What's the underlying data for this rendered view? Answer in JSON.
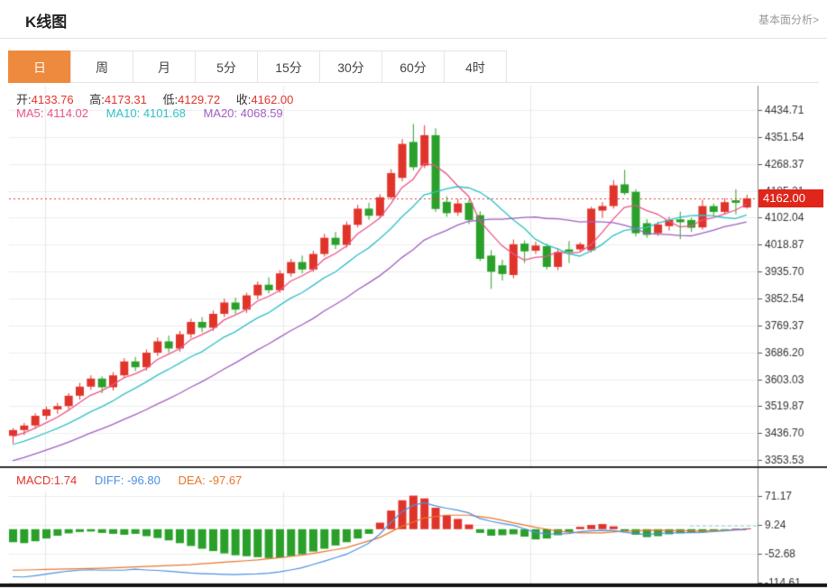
{
  "header": {
    "title": "K线图",
    "analysis_link": "基本面分析>"
  },
  "tabs": {
    "items": [
      {
        "label": "日",
        "active": true
      },
      {
        "label": "周",
        "active": false
      },
      {
        "label": "月",
        "active": false
      },
      {
        "label": "5分",
        "active": false
      },
      {
        "label": "15分",
        "active": false
      },
      {
        "label": "30分",
        "active": false
      },
      {
        "label": "60分",
        "active": false
      },
      {
        "label": "4时",
        "active": false
      }
    ]
  },
  "ohlc": {
    "open_label": "开:",
    "open_value": "4133.76",
    "high_label": "高:",
    "high_value": "4173.31",
    "low_label": "低:",
    "low_value": "4129.72",
    "close_label": "收:",
    "close_value": "4162.00"
  },
  "ma": {
    "ma5_label": "MA5:",
    "ma5_value": "4114.02",
    "ma10_label": "MA10:",
    "ma10_value": "4101.68",
    "ma20_label": "MA20:",
    "ma20_value": "4068.59"
  },
  "macd_legend": {
    "macd_label": "MACD:",
    "macd_value": "1.74",
    "diff_label": "DIFF:",
    "diff_value": "-96.80",
    "dea_label": "DEA:",
    "dea_value": "-97.67"
  },
  "price_marker": {
    "label": "4162.00"
  },
  "colors": {
    "up": "#e0342b",
    "down": "#2aa02a",
    "ma5": "#ea5586",
    "ma10": "#2fc1c9",
    "ma20": "#a05fc0",
    "diff": "#4b90e2",
    "dea": "#e8762c",
    "tab_accent": "#ee8a3d",
    "price_marker_bg": "#e0251a",
    "dotted_line": "#e03b2f",
    "grid": "#ececec",
    "axis": "#999",
    "axis_text": "#333"
  },
  "chart_data": {
    "type": "candlestick_with_macd",
    "current_price": 4162.0,
    "price_axis": {
      "max": 4434.71,
      "step": 83.17,
      "labels": [
        "4434.71",
        "4351.54",
        "4268.37",
        "4185.21",
        "4102.04",
        "4018.87",
        "3935.70",
        "3852.54",
        "3769.37",
        "3686.20",
        "3603.03",
        "3519.87",
        "3436.70",
        "3353.53"
      ]
    },
    "v_gridlines_x": [
      50,
      314,
      588
    ],
    "ma_periods": [
      5,
      10,
      20
    ],
    "pre_trend": {
      "count": 20,
      "step": 10
    },
    "candles": [
      [
        3428,
        3452,
        3405,
        3446
      ],
      [
        3446,
        3468,
        3430,
        3460
      ],
      [
        3460,
        3498,
        3450,
        3490
      ],
      [
        3490,
        3518,
        3478,
        3510
      ],
      [
        3510,
        3530,
        3496,
        3520
      ],
      [
        3520,
        3560,
        3508,
        3552
      ],
      [
        3552,
        3592,
        3540,
        3580
      ],
      [
        3580,
        3615,
        3570,
        3605
      ],
      [
        3605,
        3612,
        3560,
        3578
      ],
      [
        3578,
        3625,
        3568,
        3615
      ],
      [
        3615,
        3668,
        3605,
        3658
      ],
      [
        3658,
        3672,
        3628,
        3640
      ],
      [
        3640,
        3695,
        3630,
        3685
      ],
      [
        3685,
        3732,
        3675,
        3720
      ],
      [
        3720,
        3738,
        3685,
        3698
      ],
      [
        3698,
        3752,
        3688,
        3742
      ],
      [
        3742,
        3790,
        3730,
        3780
      ],
      [
        3780,
        3795,
        3748,
        3762
      ],
      [
        3762,
        3815,
        3752,
        3805
      ],
      [
        3805,
        3852,
        3795,
        3840
      ],
      [
        3840,
        3855,
        3805,
        3818
      ],
      [
        3818,
        3870,
        3808,
        3862
      ],
      [
        3862,
        3905,
        3850,
        3895
      ],
      [
        3895,
        3918,
        3868,
        3878
      ],
      [
        3878,
        3940,
        3870,
        3930
      ],
      [
        3930,
        3975,
        3920,
        3965
      ],
      [
        3965,
        3985,
        3930,
        3942
      ],
      [
        3942,
        4000,
        3935,
        3990
      ],
      [
        3990,
        4052,
        3982,
        4040
      ],
      [
        4040,
        4058,
        4005,
        4018
      ],
      [
        4018,
        4090,
        4010,
        4080
      ],
      [
        4080,
        4142,
        4072,
        4130
      ],
      [
        4130,
        4148,
        4095,
        4108
      ],
      [
        4108,
        4175,
        4100,
        4165
      ],
      [
        4165,
        4252,
        4158,
        4240
      ],
      [
        4225,
        4345,
        4215,
        4330
      ],
      [
        4336,
        4392,
        4248,
        4258
      ],
      [
        4263,
        4388,
        4255,
        4357
      ],
      [
        4357,
        4378,
        4120,
        4129
      ],
      [
        4151,
        4168,
        4105,
        4116
      ],
      [
        4118,
        4160,
        4108,
        4146
      ],
      [
        4148,
        4158,
        4082,
        4095
      ],
      [
        4110,
        4122,
        3968,
        3975
      ],
      [
        3985,
        4002,
        3882,
        3935
      ],
      [
        3955,
        3972,
        3908,
        3928
      ],
      [
        3925,
        4035,
        3915,
        4020
      ],
      [
        4022,
        4032,
        3962,
        3998
      ],
      [
        4000,
        4028,
        3990,
        4016
      ],
      [
        4014,
        4022,
        3942,
        3950
      ],
      [
        3950,
        4008,
        3940,
        3996
      ],
      [
        4004,
        4030,
        3962,
        3996
      ],
      [
        4004,
        4026,
        3996,
        4020
      ],
      [
        4001,
        4136,
        3995,
        4130
      ],
      [
        4124,
        4150,
        4102,
        4138
      ],
      [
        4138,
        4218,
        4130,
        4202
      ],
      [
        4205,
        4250,
        4172,
        4178
      ],
      [
        4182,
        4190,
        4044,
        4054
      ],
      [
        4085,
        4098,
        4040,
        4049
      ],
      [
        4054,
        4090,
        4046,
        4081
      ],
      [
        4076,
        4105,
        4062,
        4095
      ],
      [
        4097,
        4121,
        4036,
        4088
      ],
      [
        4095,
        4102,
        4058,
        4071
      ],
      [
        4072,
        4158,
        4065,
        4138
      ],
      [
        4138,
        4146,
        4108,
        4120
      ],
      [
        4120,
        4162,
        4112,
        4150
      ],
      [
        4156,
        4190,
        4112,
        4148
      ],
      [
        4133.76,
        4173.31,
        4129.72,
        4162.0
      ]
    ],
    "macd": {
      "axis": {
        "max": 71.17,
        "step": 61.93,
        "labels": [
          "71.17",
          "9.24",
          "-52.68",
          "-114.61"
        ]
      },
      "hist": [
        -28,
        -30,
        -26,
        -20,
        -14,
        -9,
        -6,
        -5,
        -8,
        -10,
        -12,
        -10,
        -15,
        -19,
        -24,
        -30,
        -36,
        -42,
        -47,
        -52,
        -56,
        -58,
        -60,
        -62,
        -61,
        -58,
        -54,
        -48,
        -42,
        -35,
        -28,
        -20,
        -10,
        14,
        40,
        62,
        72,
        66,
        46,
        30,
        22,
        10,
        -8,
        -14,
        -13,
        -11,
        -16,
        -22,
        -20,
        -13,
        -7,
        5,
        9,
        11,
        6,
        -5,
        -12,
        -17,
        -15,
        -11,
        -9,
        -8,
        -6,
        -4,
        -2,
        1,
        1.74
      ],
      "dea_keypoints": [
        [
          0,
          -88
        ],
        [
          8,
          -84
        ],
        [
          16,
          -76
        ],
        [
          22,
          -66
        ],
        [
          26,
          -56
        ],
        [
          30,
          -40
        ],
        [
          33,
          -18
        ],
        [
          35,
          6
        ],
        [
          37,
          24
        ],
        [
          39,
          30
        ],
        [
          41,
          30
        ],
        [
          43,
          24
        ],
        [
          45,
          14
        ],
        [
          47,
          4
        ],
        [
          49,
          -4
        ],
        [
          51,
          -8
        ],
        [
          53,
          -8
        ],
        [
          55,
          -4
        ],
        [
          58,
          -2
        ],
        [
          62,
          -4
        ],
        [
          66,
          -1
        ]
      ]
    }
  }
}
